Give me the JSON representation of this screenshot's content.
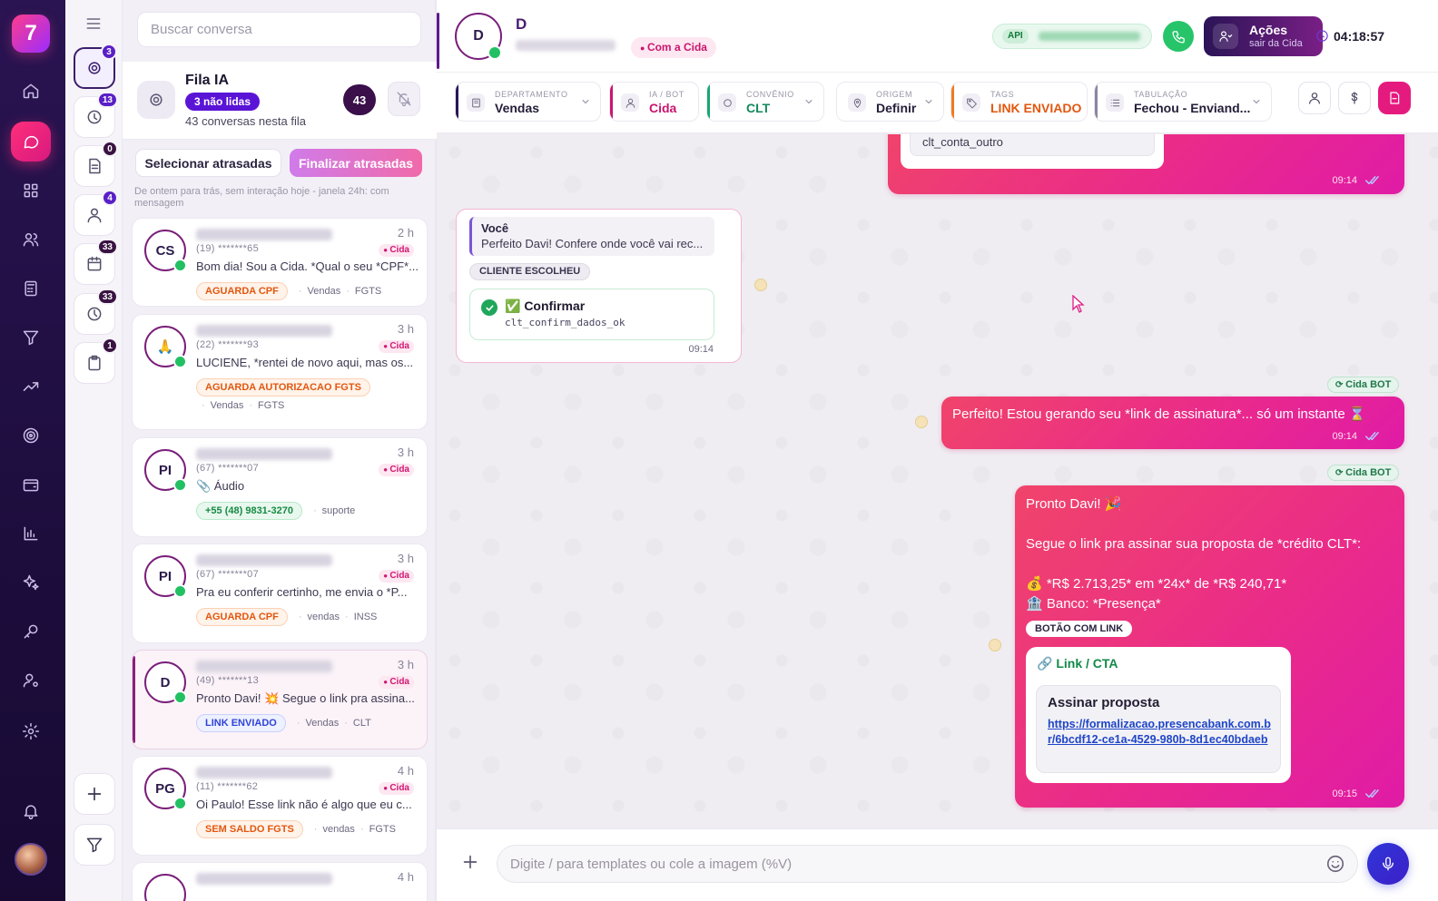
{
  "rail": {
    "logo": "7",
    "items": [
      {
        "icon": "home-icon"
      },
      {
        "icon": "chat-icon",
        "active": true
      },
      {
        "icon": "grid-icon"
      },
      {
        "icon": "users-icon"
      },
      {
        "icon": "calculator-icon"
      },
      {
        "icon": "funnel-icon"
      },
      {
        "icon": "trend-up-icon"
      },
      {
        "icon": "target-icon"
      },
      {
        "icon": "wallet-icon"
      },
      {
        "icon": "bar-chart-icon"
      },
      {
        "icon": "sparkles-icon"
      },
      {
        "icon": "key-icon"
      },
      {
        "icon": "user-settings-icon"
      },
      {
        "icon": "gear-icon"
      },
      {
        "icon": "bell-icon"
      }
    ]
  },
  "queues": [
    {
      "icon": "robot-queue-icon",
      "badge": "3",
      "active": true
    },
    {
      "icon": "clock-down-icon",
      "badge": "13"
    },
    {
      "icon": "document-icon",
      "badge": "0",
      "dark": true
    },
    {
      "icon": "person-icon",
      "badge": "4"
    },
    {
      "icon": "calendar-icon",
      "badge": "33",
      "dark": true
    },
    {
      "icon": "clock-icon",
      "badge": "33",
      "dark": true
    },
    {
      "icon": "clipboard-icon",
      "badge": "1",
      "dark": true
    }
  ],
  "list": {
    "search_placeholder": "Buscar conversa",
    "queue_title": "Fila IA",
    "unread_badge": "3 não lidas",
    "queue_count_text": "43 conversas nesta fila",
    "queue_count": "43",
    "select_late": "Selecionar atrasadas",
    "finalize_late": "Finalizar atrasadas",
    "hint": "De ontem para trás, sem interação hoje - janela 24h: com mensagem",
    "conversations": [
      {
        "initials": "CS",
        "time": "2 h",
        "phone": "(19) *******65",
        "agent": "Cida",
        "message": "Bom dia! Sou a Cida. *Qual o seu *CPF*...",
        "tag": "AGUARDA CPF",
        "tag_color": "orange",
        "meta": [
          "Vendas",
          "FGTS"
        ]
      },
      {
        "initials": "🙏",
        "time": "3 h",
        "phone": "(22) *******93",
        "agent": "Cida",
        "message": "LUCIENE, *rentei de novo aqui, mas os...",
        "tag": "AGUARDA AUTORIZACAO FGTS",
        "tag_color": "orange",
        "meta": [
          "Vendas",
          "FGTS"
        ]
      },
      {
        "initials": "PI",
        "time": "3 h",
        "phone": "(67) *******07",
        "agent": "Cida",
        "message": "📎 Áudio",
        "tag": "+55 (48) 9831-3270",
        "tag_color": "green",
        "meta": [
          "suporte"
        ]
      },
      {
        "initials": "PI",
        "time": "3 h",
        "phone": "(67) *******07",
        "agent": "Cida",
        "message": "Pra eu conferir certinho, me envia o *P...",
        "tag": "AGUARDA CPF",
        "tag_color": "orange",
        "meta": [
          "vendas",
          "INSS"
        ]
      },
      {
        "initials": "D",
        "time": "3 h",
        "phone": "(49) *******13",
        "agent": "Cida",
        "message": "Pronto Davi! 💥 Segue o link pra assina...",
        "tag": "LINK ENVIADO",
        "tag_color": "blue",
        "meta": [
          "Vendas",
          "CLT"
        ],
        "selected": true
      },
      {
        "initials": "PG",
        "time": "4 h",
        "phone": "(11) *******62",
        "agent": "Cida",
        "message": "Oi Paulo! Esse link não é algo que eu c...",
        "tag": "SEM SALDO FGTS",
        "tag_color": "orange",
        "meta": [
          "vendas",
          "FGTS"
        ]
      },
      {
        "initials": "",
        "time": "4 h",
        "phone": "",
        "agent": "",
        "message": "",
        "tag": "",
        "tag_color": "orange",
        "meta": []
      }
    ]
  },
  "chat": {
    "contact_initial": "D",
    "contact_name": "D",
    "with_agent": "Com a Cida",
    "api_label": "API",
    "actions_label": "Ações",
    "actions_sub": "sair da Cida",
    "timer": "04:18:57",
    "fields": [
      {
        "label": "DEPARTAMENTO",
        "value": "Vendas",
        "icon": "building-icon",
        "accent": "#2a1456",
        "value_color": "#241e38"
      },
      {
        "label": "IA / BOT",
        "value": "Cida",
        "icon": "person-pink-icon",
        "accent": "#c9156e",
        "value_color": "#c9156e"
      },
      {
        "label": "CONVÊNIO",
        "value": "CLT",
        "icon": "circle-icon",
        "accent": "#18a772",
        "value_color": "#128a5a"
      },
      {
        "label": "ORIGEM",
        "value": "Definir",
        "icon": "pin-icon",
        "accent": "#ffffff",
        "value_color": "#241e38"
      },
      {
        "label": "TAGS",
        "value": "LINK ENVIADO",
        "icon": "tag-icon",
        "accent": "#f07a1f",
        "value_color": "#e2570f"
      },
      {
        "label": "TABULAÇÃO",
        "value": "Fechou - Enviand...",
        "icon": "list-icon",
        "accent": "#8a86a0",
        "value_color": "#241e38"
      }
    ],
    "messages": {
      "top_bubble_code": "clt_conta_outro",
      "top_bubble_time": "09:14",
      "reply_author": "Você",
      "reply_text": "Perfeito Davi! Confere onde você vai rec...",
      "chosen_tag": "CLIENTE ESCOLHEU",
      "confirm_label": "✅ Confirmar",
      "confirm_code": "clt_confirm_dados_ok",
      "in_time": "09:14",
      "bot_tag": "Cida BOT",
      "msg2_text": "Perfeito! Estou gerando seu *link de assinatura*... só um instante ⌛",
      "msg2_time": "09:14",
      "msg3_text": "Pronto Davi! 🎉\n\nSegue o link pra assinar sua proposta de *crédito CLT*:\n\n💰 *R$ 2.713,25* em *24x* de *R$ 240,71*\n🏦 Banco: *Presença*",
      "link_tag": "BOTÃO COM LINK",
      "cta_header": "Link / CTA",
      "cta_title": "Assinar proposta",
      "cta_link": "https://formalizacao.presencabank.com.br/6bcdf12-ce1a-4529-980b-8d1ec40bdaeb",
      "msg3_time": "09:15"
    },
    "composer_placeholder": "Digite / para templates ou cole a imagem (%V)"
  }
}
